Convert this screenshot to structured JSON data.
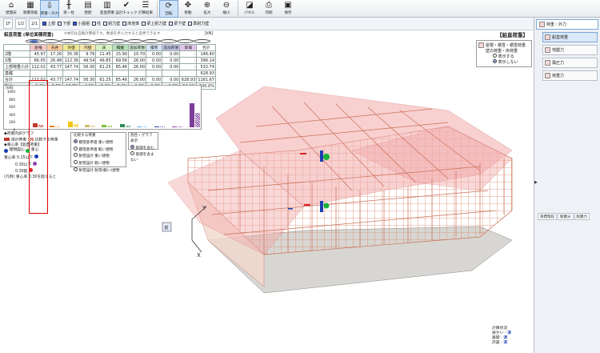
{
  "toolbar": {
    "buttons": [
      {
        "label": "壁量床",
        "icon": "⌂"
      },
      {
        "label": "耐震等級",
        "icon": "▦"
      },
      {
        "label": "荷重・外力",
        "icon": "⇩"
      },
      {
        "label": "梁・柱",
        "icon": "╫"
      },
      {
        "label": "壁配",
        "icon": "▤"
      },
      {
        "label": "鉛直荷重",
        "icon": "▥"
      },
      {
        "label": "設計チェック",
        "icon": "✔"
      },
      {
        "label": "計算結果",
        "icon": "☰"
      },
      {
        "label": "回転",
        "icon": "⟳"
      },
      {
        "label": "移動",
        "icon": "✥"
      },
      {
        "label": "拡大",
        "icon": "⊕"
      },
      {
        "label": "縮小",
        "icon": "⊖"
      },
      {
        "label": "パネル",
        "icon": "◪"
      },
      {
        "label": "印刷",
        "icon": "⎙"
      },
      {
        "label": "保存",
        "icon": "▣"
      }
    ]
  },
  "toolbar2": {
    "buttons": [
      "1F",
      "1/2",
      "2/1"
    ],
    "checks": [
      {
        "label": "上部",
        "on": true
      },
      {
        "label": "下部",
        "on": false
      },
      {
        "label": "小屋組",
        "on": true
      },
      {
        "label": "柱",
        "on": false
      },
      {
        "label": "耐力壁",
        "on": false
      },
      {
        "label": "床倍率",
        "on": false
      },
      {
        "label": "梁上耐力壁",
        "on": false
      },
      {
        "label": "梁下壁",
        "on": false
      },
      {
        "label": "準耐力壁",
        "on": false
      }
    ]
  },
  "panel": {
    "title": "鉛直荷重 (単位面積荷重)",
    "note": "※本印は自動計算値です。数値を手入力すると変更できます",
    "unit": "[kN]",
    "headers": [
      "",
      "屋根",
      "天井",
      "外壁",
      "内壁",
      "床",
      "積載",
      "追加荷重",
      "積雪",
      "追加荷重",
      "単価",
      "合計"
    ],
    "rows": [
      {
        "label": "2階",
        "values": [
          "45.97",
          "17.26",
          "35.36",
          "9.76",
          "11.45",
          "15.90",
          "10.70",
          "0.00",
          "0.00",
          "-",
          "146.40"
        ]
      },
      {
        "label": "1階",
        "values": [
          "66.05",
          "26.48",
          "112.36",
          "49.54",
          "49.85",
          "69.56",
          "26.00",
          "0.00",
          "0.00",
          "-",
          "396.14"
        ]
      },
      {
        "label": "上部荷重小計",
        "values": [
          "112.02",
          "43.77",
          "147.74",
          "56.30",
          "61.25",
          "85.46",
          "26.00",
          "0.00",
          "0.00",
          "-",
          "532.74"
        ]
      },
      {
        "label": "基礎",
        "values": [
          "",
          "",
          "",
          "",
          "",
          "",
          "",
          "",
          "",
          "",
          "628.93"
        ]
      },
      {
        "label": "合計",
        "values": [
          "112.02",
          "43.77",
          "147.74",
          "56.30",
          "61.25",
          "85.46",
          "26.00",
          "0.00",
          "0.00",
          "628.93",
          "1161.67"
        ]
      },
      {
        "label": "割合",
        "values": [
          "9.6%",
          "3.8%",
          "12.7%",
          "4.9%",
          "5.3%",
          "7.4%",
          "2.2%",
          "0.0%",
          "0.0%",
          "54.1%",
          "100.0%"
        ]
      }
    ],
    "header_colors": [
      "#ffffff",
      "#f6c7c7",
      "#f7c99b",
      "#f0e891",
      "#f7e4a8",
      "#d8efc4",
      "#b7e0b7",
      "#cfe8cf",
      "#d9e5f5",
      "#c9c9ea",
      "#e0c6ea",
      "#ffffff"
    ]
  },
  "barchart": {
    "unit": "[kN]",
    "ticks": [
      "1000",
      "800",
      "600",
      "400",
      "200",
      "0"
    ],
    "bars": [
      {
        "value": 112.02,
        "color": "#c0392b"
      },
      {
        "value": 43.77,
        "color": "#e67e22"
      },
      {
        "value": 147.74,
        "color": "#f1c40f"
      },
      {
        "value": 56.3,
        "color": "#d4b86a"
      },
      {
        "value": 61.25,
        "color": "#7cbf3c"
      },
      {
        "value": 85.46,
        "color": "#2e8b57"
      },
      {
        "value": 26.0,
        "color": "#5dade2"
      },
      {
        "value": 0,
        "color": "#3949ab"
      },
      {
        "value": 0,
        "color": "#8e44ad"
      },
      {
        "value": 628.93,
        "color": "#7d3c98"
      }
    ]
  },
  "legend": {
    "graph_label": "◆荷重内訳グラフ",
    "sw1": "設計荷重",
    "sw2": "比較する荷重",
    "center_title": "◆重心率【鉛直荷重】",
    "cg_label": "建物図心",
    "cg2_label": "重心",
    "r1": "重心率 0.15以下",
    "r2": "0.30以下",
    "r3": "0.30超",
    "foot": "(凡例) 重心率 0.30を超えると"
  },
  "compare": {
    "title": "比較する荷重",
    "options": [
      {
        "label": "積雪基準値 重い建物",
        "on": true
      },
      {
        "label": "積雪基準値 軽い建物",
        "on": false
      },
      {
        "label": "耐雪設計 重い建物",
        "on": false
      },
      {
        "label": "耐雪設計 軽い建物",
        "on": false
      },
      {
        "label": "耐雪設計 耐雪(軽い)建物",
        "on": false
      }
    ]
  },
  "display": {
    "title": "割合・グラフ表示",
    "options": [
      {
        "label": "基礎を含む",
        "on": true
      },
      {
        "label": "基礎を含まない",
        "on": false
      }
    ]
  },
  "vbox": {
    "title": "【鉛直荷重】",
    "line1": "屋根・積雪・積雪荷重",
    "line2": "壁の荷重・床荷重",
    "opt1": "表示する",
    "opt2": "表示しない"
  },
  "calc": {
    "title": "計算状況",
    "rows": [
      {
        "label": "梁せい",
        "state": "済"
      },
      {
        "label": "基礎",
        "state": "済"
      },
      {
        "label": "許容",
        "state": "済"
      }
    ]
  },
  "sidebar": {
    "head": "荷重・外力",
    "items": [
      "鉛直荷重",
      "地震力",
      "風圧力",
      "荷重力"
    ],
    "tabs": [
      "目標階段",
      "耐震分",
      "耐震力"
    ]
  }
}
